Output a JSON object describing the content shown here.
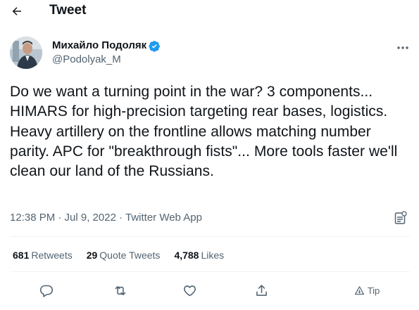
{
  "header": {
    "title": "Tweet",
    "back_icon": "arrow-left-icon"
  },
  "author": {
    "display_name": "Михайло Подоляк",
    "handle": "@Podolyak_M",
    "verified_icon": "verified-badge-icon",
    "verified_color": "#1d9bf0"
  },
  "tweet": {
    "text": "Do we want a turning point in the war? 3 components... HIMARS for high-precision targeting rear bases, logistics. Heavy artillery on the frontline allows matching number parity. APC for \"breakthrough fists\"... More tools faster we'll clean our land of the Russians."
  },
  "meta": {
    "text": "12:38 PM · Jul 9, 2022 · Twitter Web App"
  },
  "stats": [
    {
      "count": "681",
      "label": "Retweets"
    },
    {
      "count": "29",
      "label": "Quote Tweets"
    },
    {
      "count": "4,788",
      "label": "Likes"
    }
  ],
  "actions": {
    "reply_icon": "reply-icon",
    "retweet_icon": "retweet-icon",
    "like_icon": "heart-icon",
    "share_icon": "share-icon",
    "tip_label": "Tip"
  },
  "colors": {
    "text": "#0f1419",
    "secondary": "#536471",
    "divider": "#eff3f4",
    "accent": "#1d9bf0"
  }
}
